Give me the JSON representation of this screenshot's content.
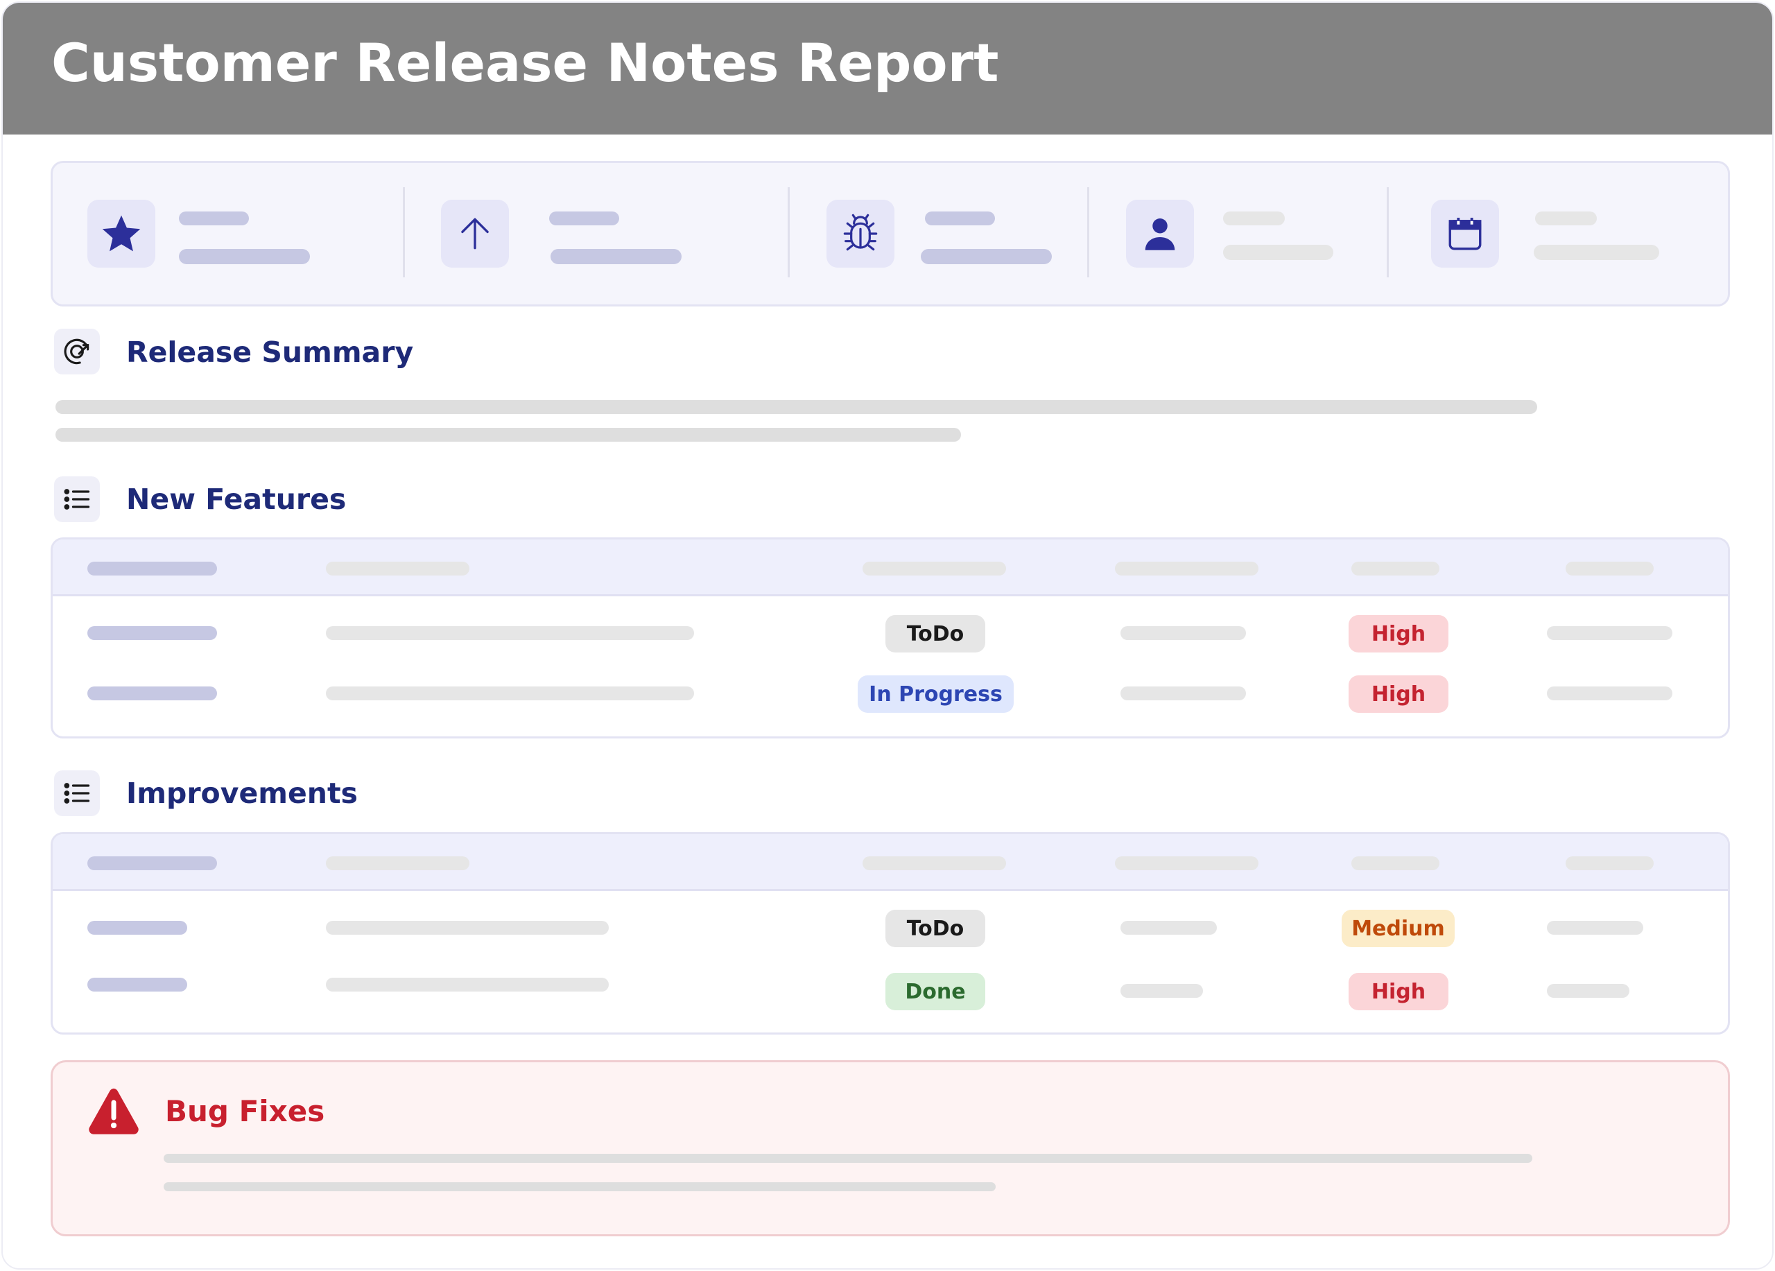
{
  "header": {
    "title": "Customer Release Notes Report"
  },
  "stats": {
    "items": [
      {
        "icon": "star-icon"
      },
      {
        "icon": "arrow-up-icon"
      },
      {
        "icon": "bug-icon"
      },
      {
        "icon": "user-icon"
      },
      {
        "icon": "calendar-icon"
      }
    ]
  },
  "sections": {
    "release_summary": {
      "title": "Release Summary",
      "icon": "release-icon"
    },
    "new_features": {
      "title": "New Features",
      "icon": "list-icon",
      "rows": [
        {
          "status": "ToDo",
          "priority": "High"
        },
        {
          "status": "In Progress",
          "priority": "High"
        }
      ]
    },
    "improvements": {
      "title": "Improvements",
      "icon": "list-icon",
      "rows": [
        {
          "status": "ToDo",
          "priority": "Medium"
        },
        {
          "status": "Done",
          "priority": "High"
        }
      ]
    },
    "bug_fixes": {
      "title": "Bug Fixes",
      "icon": "warning-icon"
    }
  },
  "colors": {
    "header_bg": "#838383",
    "accent": "#1e2a78",
    "danger": "#c8202e"
  }
}
